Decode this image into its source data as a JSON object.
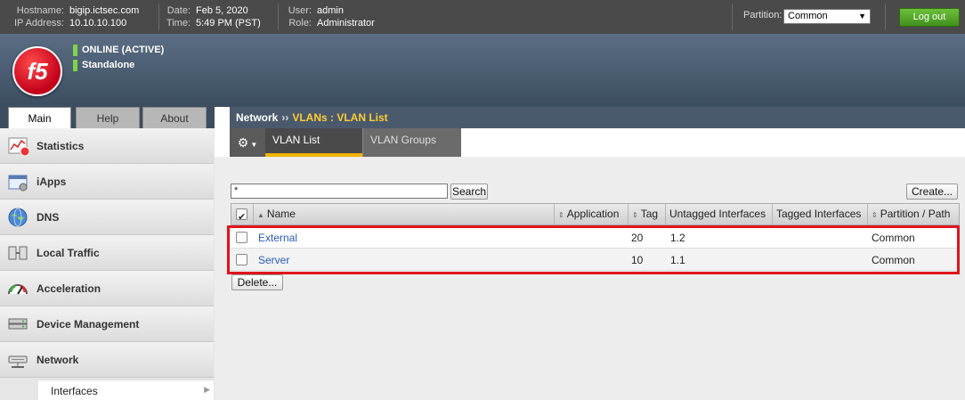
{
  "topbar": {
    "hostname_label": "Hostname:",
    "hostname": "bigip.ictsec.com",
    "ip_label": "IP Address:",
    "ip": "10.10.10.100",
    "date_label": "Date:",
    "date": "Feb 5, 2020",
    "time_label": "Time:",
    "time": "5:49 PM (PST)",
    "user_label": "User:",
    "user": "admin",
    "role_label": "Role:",
    "role": "Administrator",
    "partition_label": "Partition:",
    "partition_value": "Common",
    "logout_label": "Log out"
  },
  "header": {
    "logo_text": "f5",
    "status_line1": "ONLINE (ACTIVE)",
    "status_line2": "Standalone"
  },
  "tabs": [
    "Main",
    "Help",
    "About"
  ],
  "sidebar": {
    "items": [
      {
        "label": "Statistics",
        "icon": "statistics-icon"
      },
      {
        "label": "iApps",
        "icon": "iapps-icon"
      },
      {
        "label": "DNS",
        "icon": "dns-globe-icon"
      },
      {
        "label": "Local Traffic",
        "icon": "local-traffic-icon"
      },
      {
        "label": "Acceleration",
        "icon": "gauge-icon"
      },
      {
        "label": "Device Management",
        "icon": "device-icon"
      },
      {
        "label": "Network",
        "icon": "network-icon"
      }
    ],
    "subitem": "Interfaces"
  },
  "breadcrumb": {
    "root": "Network",
    "separator": "››",
    "current": "VLANs : VLAN List"
  },
  "subtabs": {
    "active": "VLAN List",
    "inactive": "VLAN Groups"
  },
  "search": {
    "value": "*",
    "button": "Search"
  },
  "create_label": "Create...",
  "delete_label": "Delete...",
  "table": {
    "columns": [
      "Name",
      "Application",
      "Tag",
      "Untagged Interfaces",
      "Tagged Interfaces",
      "Partition / Path"
    ],
    "rows": [
      {
        "name": "External",
        "application": "",
        "tag": "20",
        "untagged": "1.2",
        "tagged": "",
        "partition": "Common"
      },
      {
        "name": "Server",
        "application": "",
        "tag": "10",
        "untagged": "1.1",
        "tagged": "",
        "partition": "Common"
      }
    ]
  },
  "colors": {
    "highlight": "#e0141c",
    "accent": "#f0b400",
    "link": "#2a5ab8"
  }
}
